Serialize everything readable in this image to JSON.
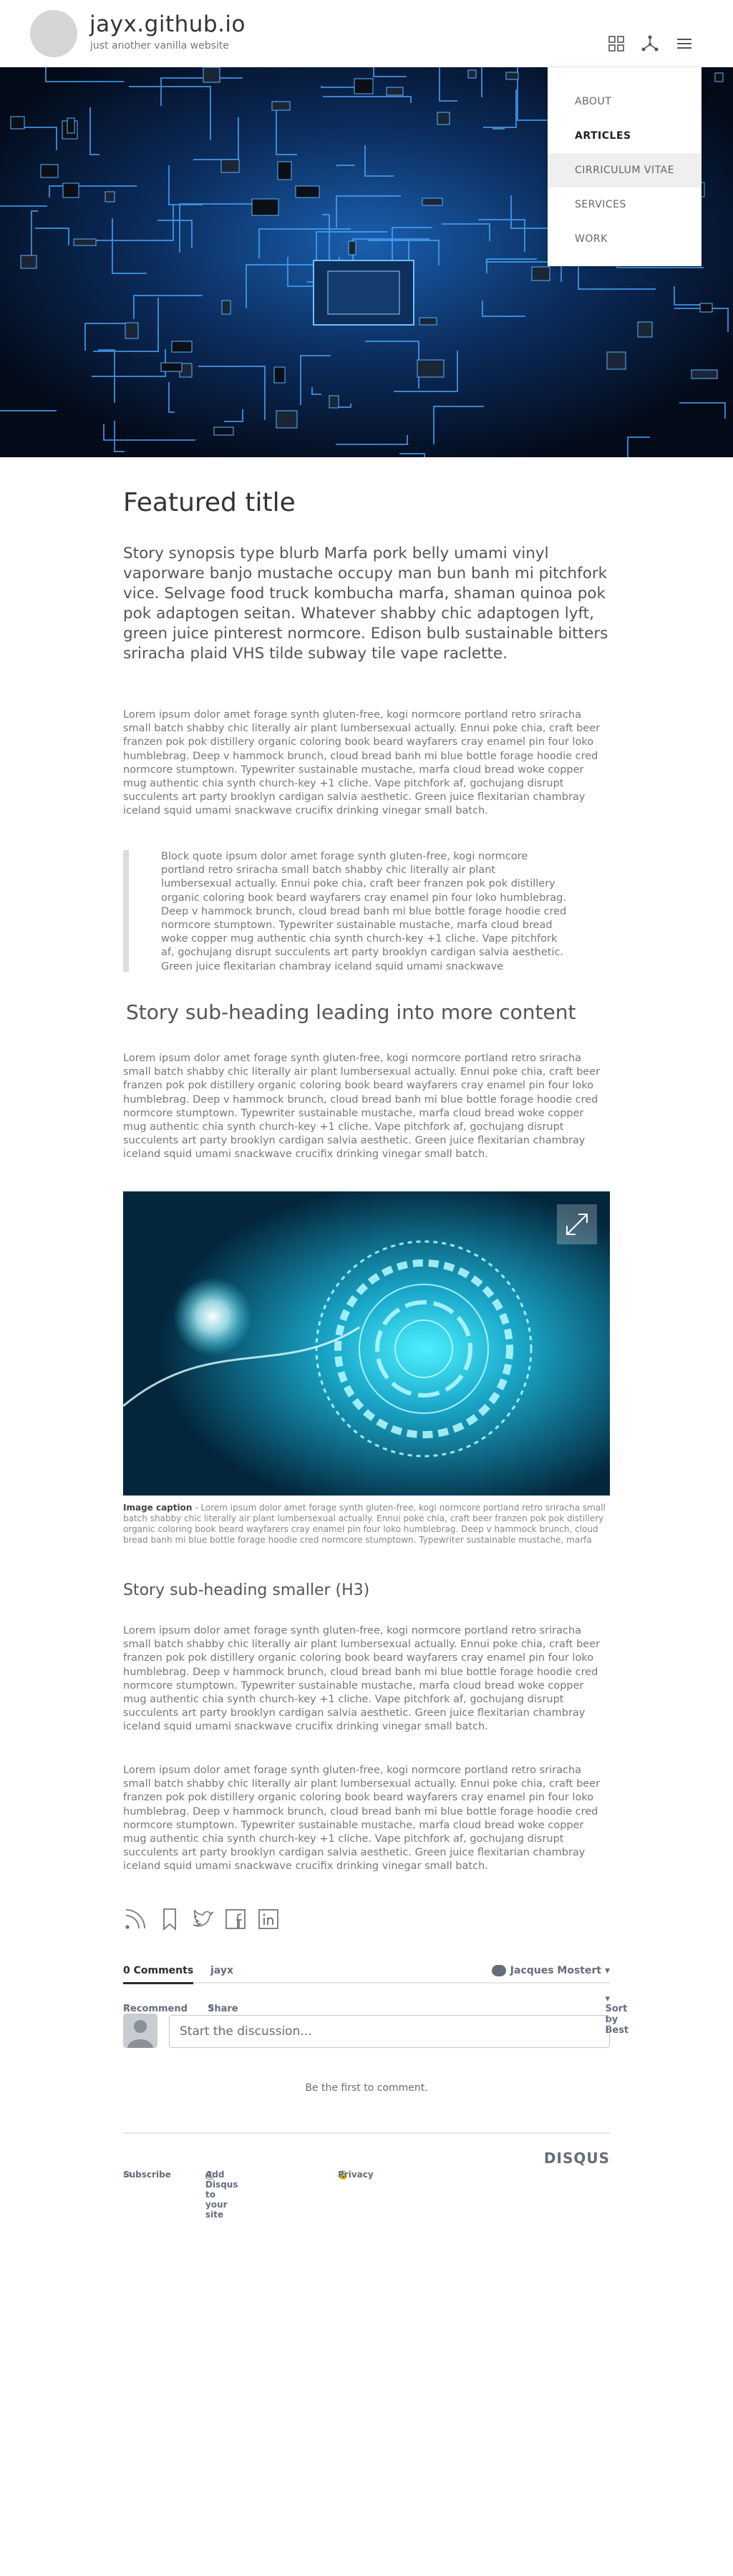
{
  "header": {
    "site_title": "jayx.github.io",
    "tagline": "just another vanilla website",
    "icons": [
      "grid-icon",
      "share-network-icon",
      "hamburger-menu-icon"
    ]
  },
  "menu": {
    "items": [
      {
        "label": "ABOUT",
        "state": "normal"
      },
      {
        "label": "ARTICLES",
        "state": "active"
      },
      {
        "label": "CIRRICULUM VITAE",
        "state": "hover"
      },
      {
        "label": "SERVICES",
        "state": "normal"
      },
      {
        "label": "WORK",
        "state": "normal"
      }
    ]
  },
  "article": {
    "featured_title": "Featured title",
    "synopsis": "Story synopsis type blurb Marfa pork belly umami vinyl vaporware banjo mustache occupy man bun banh mi pitchfork vice. Selvage food truck kombucha marfa, shaman quinoa pok pok adaptogen seitan. Whatever shabby chic adaptogen lyft, green juice pinterest normcore. Edison bulb sustainable bitters sriracha plaid VHS tilde subway tile vape raclette.",
    "para1": "Lorem ipsum dolor amet forage synth gluten-free, kogi normcore portland retro sriracha small batch shabby chic literally air plant lumbersexual actually. Ennui poke chia, craft beer franzen pok pok distillery organic coloring book beard wayfarers cray enamel pin four loko humblebrag. Deep v hammock brunch, cloud bread banh mi blue bottle forage hoodie cred normcore stumptown. Typewriter sustainable mustache, marfa cloud bread woke copper mug authentic chia synth church-key +1 cliche. Vape pitchfork af, gochujang disrupt succulents art party brooklyn cardigan salvia aesthetic. Green juice flexitarian chambray iceland squid umami snackwave crucifix drinking vinegar small batch.",
    "blockquote": "Block quote ipsum dolor amet forage synth gluten-free, kogi normcore portland retro sriracha small batch shabby chic literally air plant lumbersexual actually. Ennui poke chia, craft beer franzen pok pok distillery organic coloring book beard wayfarers cray enamel pin four loko humblebrag. Deep v hammock brunch, cloud bread banh mi blue bottle forage hoodie cred normcore stumptown. Typewriter sustainable mustache, marfa cloud bread woke copper mug authentic chia synth church-key +1 cliche. Vape pitchfork af, gochujang disrupt succulents art party brooklyn cardigan salvia aesthetic. Green juice flexitarian chambray iceland squid umami snackwave",
    "subheading": "Story sub-heading leading into more content",
    "para2": "Lorem ipsum dolor amet forage synth gluten-free, kogi normcore portland retro sriracha small batch shabby chic literally air plant lumbersexual actually. Ennui poke chia, craft beer franzen pok pok distillery organic coloring book beard wayfarers cray enamel pin four loko humblebrag. Deep v hammock brunch, cloud bread banh mi blue bottle forage hoodie cred normcore stumptown. Typewriter sustainable mustache, marfa cloud bread woke copper mug authentic chia synth church-key +1 cliche. Vape pitchfork af, gochujang disrupt succulents art party brooklyn cardigan salvia aesthetic. Green juice flexitarian chambray iceland squid umami snackwave crucifix drinking vinegar small batch.",
    "caption_label": "Image caption",
    "caption_text": " - Lorem ipsum dolor amet forage synth gluten-free, kogi normcore portland retro sriracha small batch shabby chic literally air plant lumbersexual actually. Ennui poke chia, craft beer franzen pok pok distillery organic coloring book beard wayfarers cray enamel pin four loko humblebrag. Deep v hammock brunch, cloud bread banh mi blue bottle forage hoodie cred normcore stumptown. Typewriter sustainable mustache, marfa",
    "subheading_h3": "Story sub-heading smaller (H3)",
    "para3": "Lorem ipsum dolor amet forage synth gluten-free, kogi normcore portland retro sriracha small batch shabby chic literally air plant lumbersexual actually. Ennui poke chia, craft beer franzen pok pok distillery organic coloring book beard wayfarers cray enamel pin four loko humblebrag. Deep v hammock brunch, cloud bread banh mi blue bottle forage hoodie cred normcore stumptown. Typewriter sustainable mustache, marfa cloud bread woke copper mug authentic chia synth church-key +1 cliche. Vape pitchfork af, gochujang disrupt succulents art party brooklyn cardigan salvia aesthetic. Green juice flexitarian chambray iceland squid umami snackwave crucifix drinking vinegar small batch.",
    "para4": "Lorem ipsum dolor amet forage synth gluten-free, kogi normcore portland retro sriracha small batch shabby chic literally air plant lumbersexual actually. Ennui poke chia, craft beer franzen pok pok distillery organic coloring book beard wayfarers cray enamel pin four loko humblebrag. Deep v hammock brunch, cloud bread banh mi blue bottle forage hoodie cred normcore stumptown. Typewriter sustainable mustache, marfa cloud bread woke copper mug authentic chia synth church-key +1 cliche. Vape pitchfork af, gochujang disrupt succulents art party brooklyn cardigan salvia aesthetic. Green juice flexitarian chambray iceland squid umami snackwave crucifix drinking vinegar small batch."
  },
  "share_icons": [
    "rss-icon",
    "bookmark-icon",
    "twitter-icon",
    "facebook-icon",
    "linkedin-icon"
  ],
  "comments": {
    "tab_comments": "0 Comments",
    "tab_site": "jayx",
    "user_name": "Jacques Mostert",
    "recommend": "Recommend",
    "share": "Share",
    "sort": "Sort by Best",
    "input_placeholder": "Start the discussion...",
    "empty_text": "Be the first to comment.",
    "footer_subscribe": "Subscribe",
    "footer_add": "Add Disqus to your site",
    "footer_privacy": "Privacy",
    "brand": "DISQUS"
  },
  "colors": {
    "hero_bg": "#06142b",
    "circuit": "#4aa8ff",
    "disqus_text": "#656c7a",
    "recommend_heart": "#e0483e"
  }
}
